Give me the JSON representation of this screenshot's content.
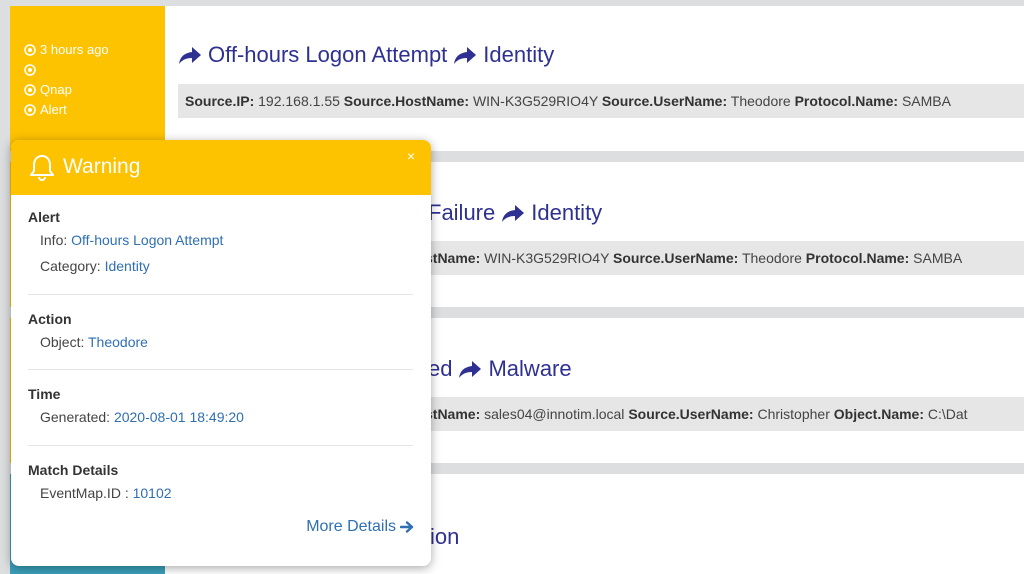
{
  "events": [
    {
      "meta": {
        "time": "3 hours ago",
        "blank": "",
        "source": "Qnap",
        "type": "Alert"
      },
      "title": "Off-hours Logon Attempt",
      "category": "Identity",
      "fields": [
        {
          "key": "Source.IP:",
          "val": "192.168.1.55"
        },
        {
          "key": "Source.HostName:",
          "val": "WIN-K3G529RIO4Y"
        },
        {
          "key": "Source.UserName:",
          "val": "Theodore"
        },
        {
          "key": "Protocol.Name:",
          "val": "SAMBA"
        }
      ]
    },
    {
      "title_visible": "Failure",
      "category": "Identity",
      "fields_visible": "stName:",
      "fields": [
        {
          "key": "Source.HostName",
          "val": "WIN-K3G529RIO4Y"
        },
        {
          "key": "Source.UserName:",
          "val": "Theodore"
        },
        {
          "key": "Protocol.Name:",
          "val": "SAMBA"
        }
      ]
    },
    {
      "title_visible": "ed",
      "category": "Malware",
      "fields_visible": "stName:",
      "fields": [
        {
          "key": "Source.HostName",
          "val": "sales04@innotim.local"
        },
        {
          "key": "Source.UserName:",
          "val": "Christopher"
        },
        {
          "key": "Object.Name:",
          "val": "C:\\Dat"
        }
      ]
    },
    {
      "title_visible": "ion"
    }
  ],
  "popup": {
    "title": "Warning",
    "close": "×",
    "alert": {
      "heading": "Alert",
      "info_label": "Info:",
      "info_value": "Off-hours Logon Attempt",
      "category_label": "Category:",
      "category_value": "Identity"
    },
    "action": {
      "heading": "Action",
      "object_label": "Object:",
      "object_value": "Theodore"
    },
    "time": {
      "heading": "Time",
      "generated_label": "Generated:",
      "generated_value": "2020-08-01 18:49:20"
    },
    "match": {
      "heading": "Match Details",
      "eventmap_label": "EventMap.ID :",
      "eventmap_value": "10102"
    },
    "more_details": "More Details"
  },
  "colors": {
    "accent": "#fdc200",
    "title": "#2e3192",
    "link": "#2f6fb3",
    "teal": "#3a9fb9"
  }
}
